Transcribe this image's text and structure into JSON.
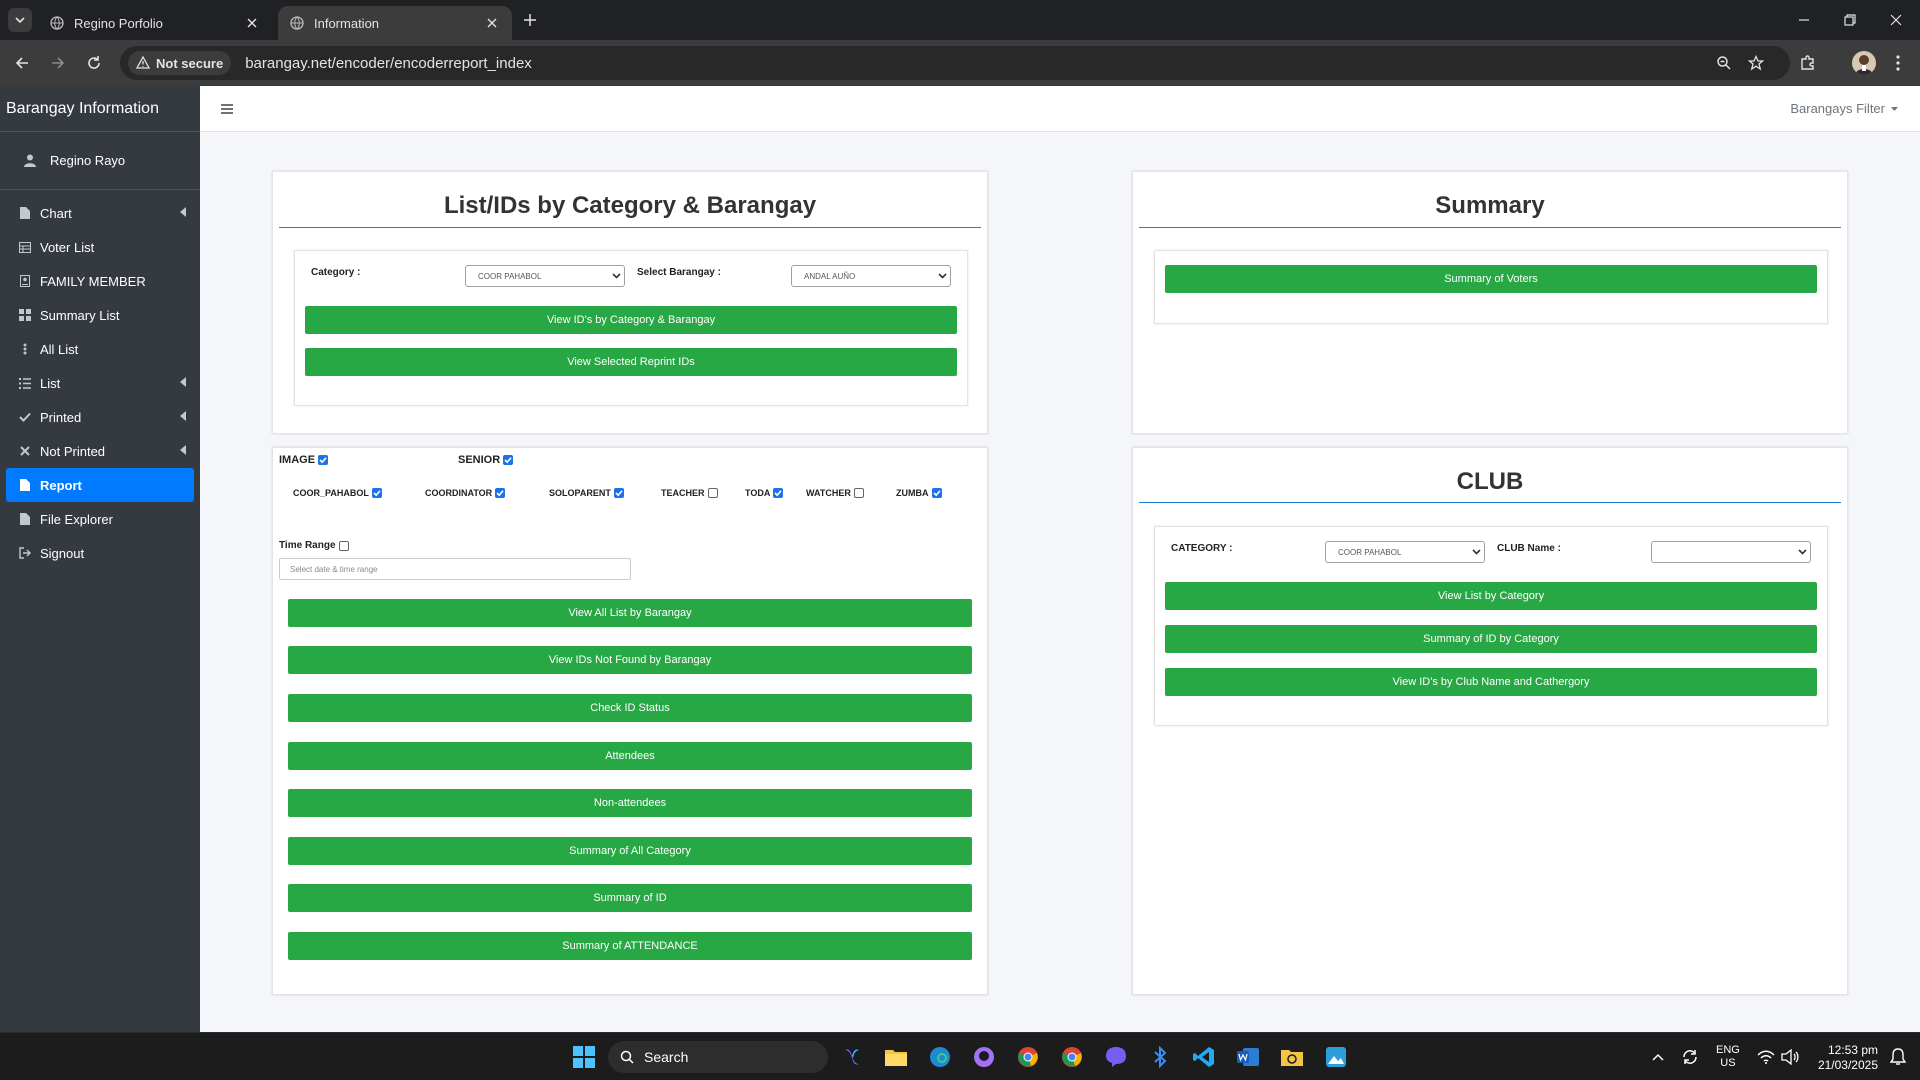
{
  "browser": {
    "tabs": [
      {
        "title": "Regino Porfolio",
        "active": false
      },
      {
        "title": "Information",
        "active": true
      }
    ],
    "security_label": "Not secure",
    "url": "barangay.net/encoder/encoderreport_index"
  },
  "sidebar": {
    "brand": "Barangay Information",
    "user_name": "Regino Rayo",
    "items": [
      {
        "label": "Chart",
        "icon": "file-icon",
        "has_chevron": true
      },
      {
        "label": "Voter List",
        "icon": "table-icon",
        "has_chevron": false
      },
      {
        "label": "FAMILY MEMBER",
        "icon": "id-card-icon",
        "has_chevron": false
      },
      {
        "label": "Summary List",
        "icon": "grid-icon",
        "has_chevron": false
      },
      {
        "label": "All List",
        "icon": "vertical-dots-icon",
        "has_chevron": false
      },
      {
        "label": "List",
        "icon": "list-icon",
        "has_chevron": true
      },
      {
        "label": "Printed",
        "icon": "check-icon",
        "has_chevron": true
      },
      {
        "label": "Not Printed",
        "icon": "x-icon",
        "has_chevron": true
      },
      {
        "label": "Report",
        "icon": "file-icon",
        "has_chevron": false,
        "active": true
      },
      {
        "label": "File Explorer",
        "icon": "file-icon",
        "has_chevron": false
      },
      {
        "label": "Signout",
        "icon": "signout-icon",
        "has_chevron": false
      }
    ]
  },
  "topnav": {
    "filter_label": "Barangays Filter"
  },
  "list_card": {
    "title": "List/IDs by Category & Barangay",
    "category_label": "Category :",
    "category_value": "COOR PAHABOL",
    "barangay_label": "Select Barangay :",
    "barangay_value": "ANDAL AUÑO",
    "btn_view_ids": "View ID's by Category & Barangay",
    "btn_reprint": "View Selected Reprint IDs"
  },
  "filters_card": {
    "image_label": "IMAGE",
    "image_checked": true,
    "senior_label": "SENIOR",
    "senior_checked": true,
    "categories": [
      {
        "label": "COOR_PAHABOL",
        "checked": true
      },
      {
        "label": "COORDINATOR",
        "checked": true
      },
      {
        "label": "SOLOPARENT",
        "checked": true
      },
      {
        "label": "TEACHER",
        "checked": false
      },
      {
        "label": "TODA",
        "checked": true
      },
      {
        "label": "WATCHER",
        "checked": false
      },
      {
        "label": "ZUMBA",
        "checked": true
      }
    ],
    "time_range_label": "Time Range",
    "time_range_checked": false,
    "time_range_placeholder": "Select date & time range",
    "buttons": [
      "View All List by Barangay",
      "View IDs Not Found by Barangay",
      "Check ID Status",
      "Attendees",
      "Non-attendees",
      "Summary of All Category",
      "Summary of ID",
      "Summary of ATTENDANCE"
    ]
  },
  "summary_card": {
    "title": "Summary",
    "btn_voters": "Summary of Voters"
  },
  "club_card": {
    "title": "CLUB",
    "category_label": "CATEGORY :",
    "category_value": "COOR PAHABOL",
    "club_label": "CLUB Name :",
    "club_value": "",
    "btn_list": "View List by Category",
    "btn_summary": "Summary of ID by Category",
    "btn_club": "View ID's by Club Name and Cathergory"
  },
  "taskbar": {
    "search_label": "Search",
    "lang_top": "ENG",
    "lang_bottom": "US",
    "time": "12:53 pm",
    "date": "21/03/2025"
  },
  "colors": {
    "sidebar_bg": "#343a40",
    "active_item": "#007bff",
    "button_green": "#28a745",
    "title_underline": "#1f7bd8"
  }
}
